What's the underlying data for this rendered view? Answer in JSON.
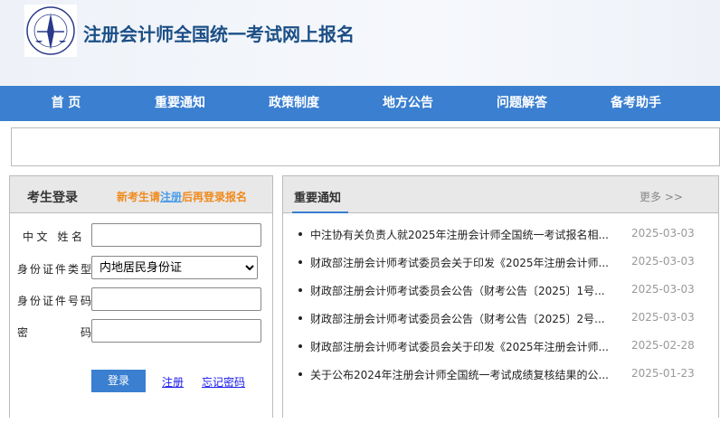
{
  "header": {
    "title": "注册会计师全国统一考试网上报名"
  },
  "nav": [
    "首 页",
    "重要通知",
    "政策制度",
    "地方公告",
    "问题解答",
    "备考助手"
  ],
  "login": {
    "title": "考生登录",
    "notice_pre": "新考生请",
    "notice_link": "注册",
    "notice_post": "后再登录报名",
    "fields": [
      {
        "label": "中文 姓名",
        "value": ""
      },
      {
        "label": "身份证件类型",
        "value": "内地居民身份证"
      },
      {
        "label": "身份证件号码",
        "value": ""
      },
      {
        "label": "密 码",
        "value": ""
      }
    ],
    "login_button": "登录",
    "register_link": "注册",
    "forgot_link": "忘记密码"
  },
  "notices": {
    "title": "重要通知",
    "more": "更多 >>",
    "items": [
      {
        "text": "中注协有关负责人就2025年注册会计师全国统一考试报名相...",
        "date": "2025-03-03"
      },
      {
        "text": "财政部注册会计师考试委员会关于印发《2025年注册会计师...",
        "date": "2025-03-03"
      },
      {
        "text": "财政部注册会计师考试委员会公告（财考公告〔2025〕1号...",
        "date": "2025-03-03"
      },
      {
        "text": "财政部注册会计师考试委员会公告（财考公告〔2025〕2号...",
        "date": "2025-03-03"
      },
      {
        "text": "财政部注册会计师考试委员会关于印发《2025年注册会计师...",
        "date": "2025-02-28"
      },
      {
        "text": "关于公布2024年注册会计师全国统一考试成绩复核结果的公...",
        "date": "2025-01-23"
      }
    ]
  }
}
